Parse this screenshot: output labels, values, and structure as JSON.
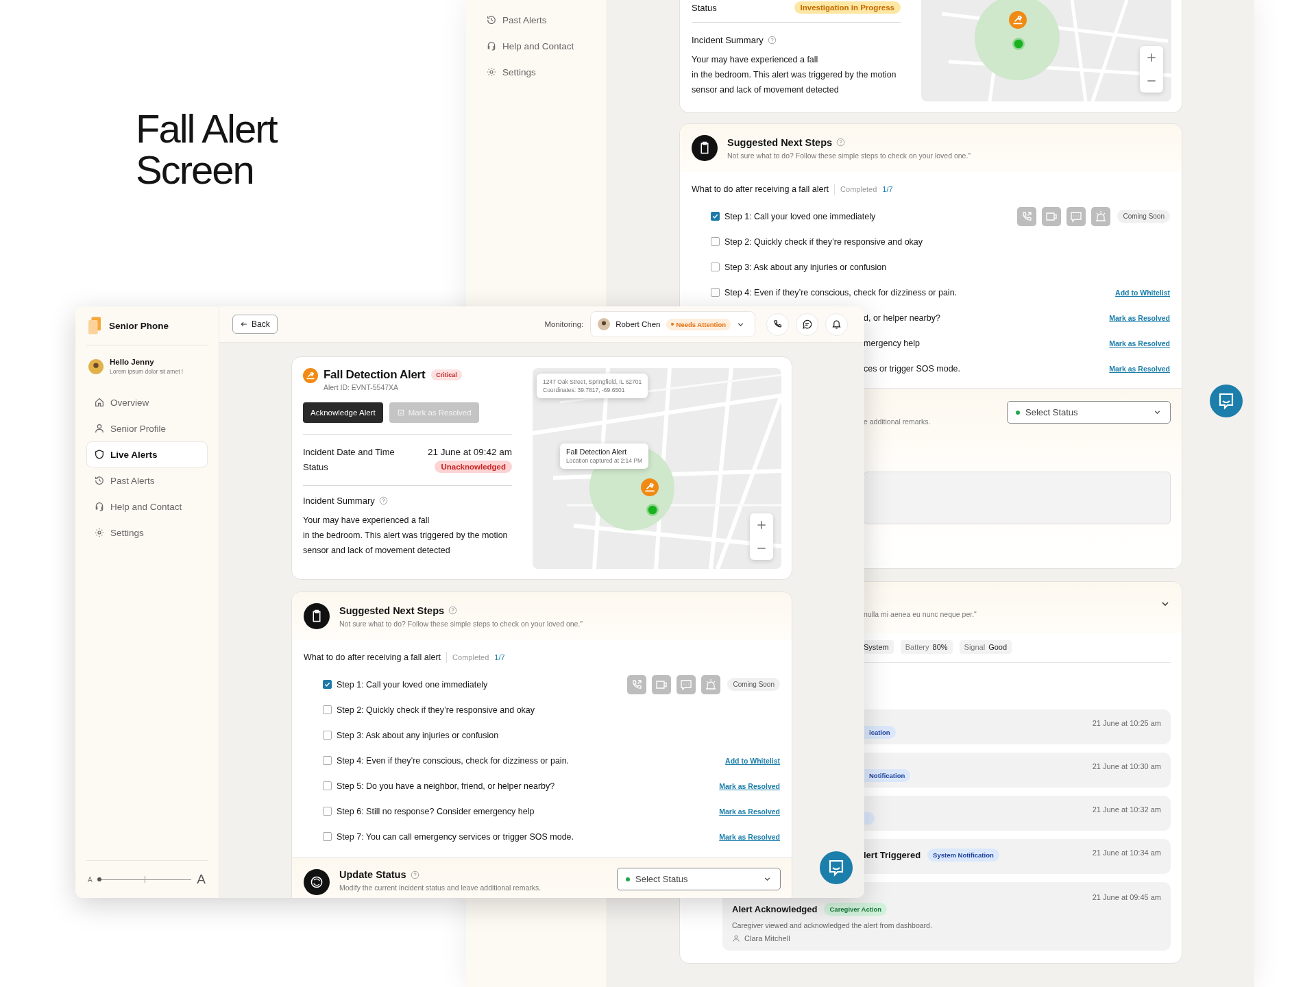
{
  "heading": "Fall Alert Screen",
  "back": {
    "sidebar": [
      {
        "label": "Past Alerts",
        "selected": false
      },
      {
        "label": "Help and Contact",
        "selected": false
      },
      {
        "label": "Settings",
        "selected": false
      }
    ],
    "incident": {
      "status_label": "Status",
      "status": "Investigation in Progress",
      "summary_title": "Incident Summary",
      "summary": [
        "Your may have experienced a fall",
        "in the bedroom. This alert was triggered by the motion",
        "sensor and lack of movement detected"
      ]
    },
    "steps": {
      "title": "Suggested Next Steps",
      "subtitle": "Not sure what to do? Follow these simple steps to check on your loved one.\"",
      "list_title": "What to do after receiving a fall alert",
      "completed_label": "Completed",
      "completed_count": "1/7",
      "coming_soon": "Coming Soon",
      "items": [
        {
          "kind": "call",
          "text": "Step 1: Call your loved one immediately",
          "checked": true
        },
        {
          "kind": "plain",
          "text": "Step 2: Quickly check if they’re responsive and okay",
          "checked": false
        },
        {
          "kind": "plain",
          "text": "Step 3: Ask about any injuries or confusion",
          "checked": false
        },
        {
          "kind": "link",
          "text": "Step 4: Even if they’re conscious, check for dizziness or pain.",
          "checked": false,
          "action": "Add to Whitelist"
        },
        {
          "kind": "link",
          "text": "d, or helper nearby?",
          "action": "Mark as Resolved"
        },
        {
          "kind": "link",
          "text": "mergency help",
          "action": "Mark as Resolved"
        },
        {
          "kind": "link",
          "text": "ces or trigger SOS mode.",
          "action": "Mark as Resolved"
        }
      ]
    },
    "update": {
      "subtitle": "e additional remarks.",
      "select_placeholder": "Select Status"
    },
    "activity": {
      "subtitle": "nulla mi aenea eu nunc neque per.\"",
      "chips": [
        {
          "value": "System"
        },
        {
          "label": "Battery",
          "value": "80%"
        },
        {
          "label": "Signal",
          "value": "Good"
        }
      ],
      "timeline": [
        {
          "kind": "system",
          "tag": "ication",
          "time": "21 June at 10:25 am"
        },
        {
          "kind": "system",
          "tag": "Notification",
          "time": "21 June at 10:30 am"
        },
        {
          "kind": "system",
          "time": "21 June at 10:32 am"
        },
        {
          "kind": "system",
          "title": "lert Triggered",
          "tag": "System Notification",
          "time": "21 June at 10:34 am"
        },
        {
          "kind": "caregiver",
          "title": "Alert Acknowledged",
          "tag": "Caregiver Action",
          "time": "21 June at 09:45 am",
          "description": "Caregiver viewed and acknowledged the alert from dashboard.",
          "person": "Clara Mitchell"
        }
      ]
    }
  },
  "front": {
    "brand": "Senior Phone",
    "user": {
      "name": "Hello Jenny",
      "tagline": "Lorem ipsum dolor sit amet !"
    },
    "nav": [
      {
        "label": "Overview",
        "selected": false
      },
      {
        "label": "Senior Profile",
        "selected": false
      },
      {
        "label": "Live Alerts",
        "selected": true
      },
      {
        "label": "Past Alerts",
        "selected": false
      },
      {
        "label": "Help and Contact",
        "selected": false
      },
      {
        "label": "Settings",
        "selected": false
      }
    ],
    "font_size": {
      "small": "A",
      "large": "A",
      "level": 0
    },
    "header": {
      "back": "Back",
      "monitoring_label": "Monitoring:",
      "person": "Robert Chen",
      "person_status": "Needs Attention"
    },
    "alert": {
      "title": "Fall Detection Alert",
      "severity": "Critical",
      "alert_id": "Alert ID: EVNT-5547XA",
      "primary_button": "Acknowledge Alert",
      "secondary_button": {
        "label": "Mark as Resolved",
        "disabled": true
      },
      "date_label": "Incident Date and Time",
      "date": "21 June at 09:42 am",
      "status_label": "Status",
      "status": "Unacknowledged",
      "summary_title": "Incident Summary",
      "summary": [
        "Your may have experienced a fall",
        "in the bedroom. This alert was triggered by the motion",
        "sensor and lack of movement detected"
      ],
      "map": {
        "address": "1247 Oak Street, Springfield, IL 62701",
        "coordinates": "Coordinates: 39.7817, -69.6501",
        "marker_title": "Fall Detection Alert",
        "marker_subtitle": "Location captured at 2:14 PM"
      }
    },
    "steps": {
      "title": "Suggested Next Steps",
      "subtitle": "Not sure what to do? Follow these simple steps to check on your loved one.\"",
      "list_title": "What to do after receiving a fall alert",
      "completed_label": "Completed",
      "completed_count": "1/7",
      "coming_soon": "Coming Soon",
      "items": [
        {
          "kind": "call",
          "text": "Step 1: Call your loved one immediately",
          "checked": true
        },
        {
          "kind": "plain",
          "text": "Step 2: Quickly check if they’re responsive and okay",
          "checked": false
        },
        {
          "kind": "plain",
          "text": "Step 3: Ask about any injuries or confusion",
          "checked": false
        },
        {
          "kind": "link",
          "text": "Step 4: Even if they’re conscious, check for dizziness or pain.",
          "checked": false,
          "action": "Add to Whitelist"
        },
        {
          "kind": "link",
          "text": "Step 5: Do you have a neighbor, friend, or helper nearby?",
          "checked": false,
          "action": "Mark as Resolved"
        },
        {
          "kind": "link",
          "text": "Step 6: Still no response? Consider emergency help",
          "checked": false,
          "action": "Mark as Resolved"
        },
        {
          "kind": "link",
          "text": "Step 7: You can call emergency services or trigger SOS mode.",
          "checked": false,
          "action": "Mark as Resolved"
        }
      ]
    },
    "update": {
      "title": "Update Status",
      "subtitle": "Modify the current incident status and leave additional remarks.",
      "select_placeholder": "Select Status"
    }
  }
}
